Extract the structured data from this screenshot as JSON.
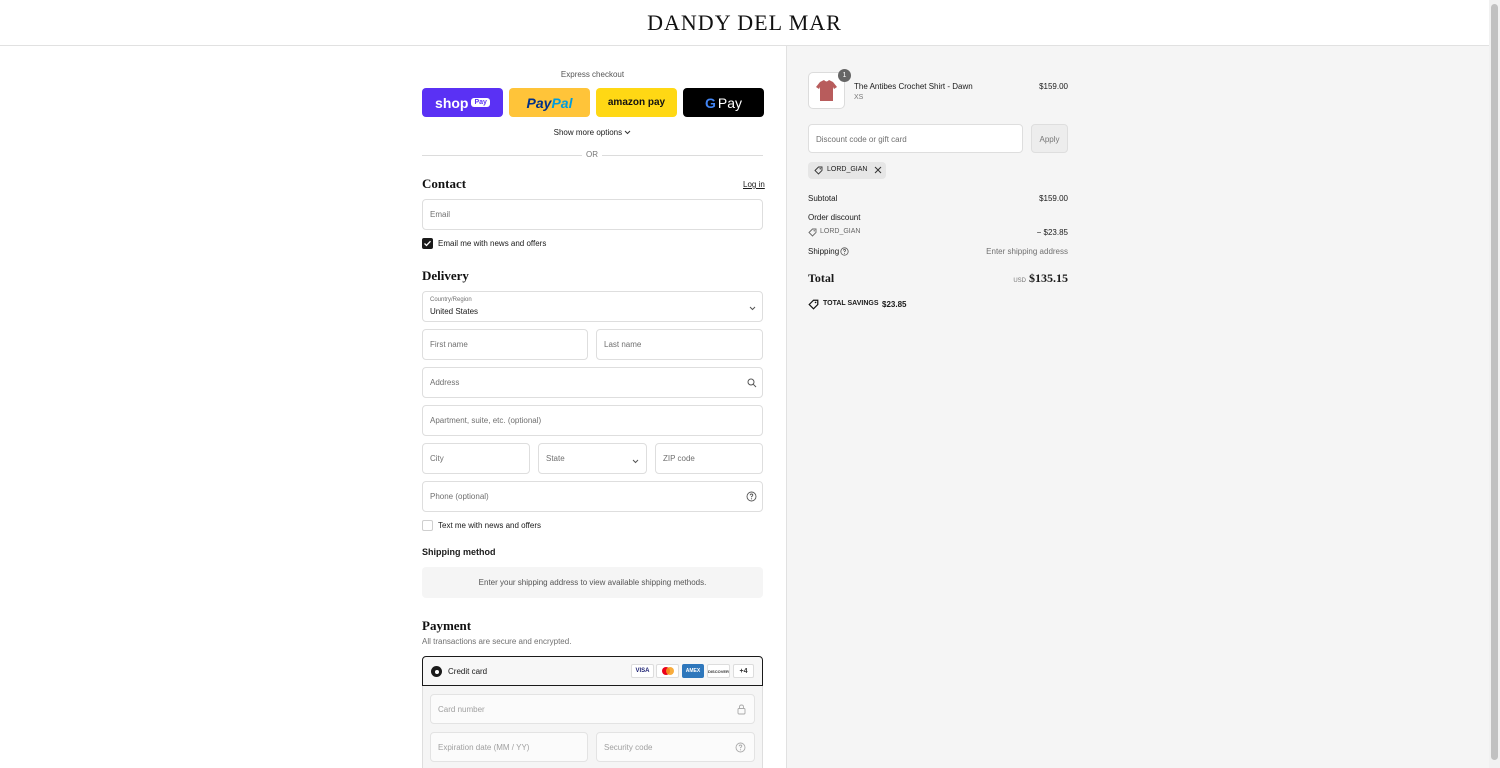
{
  "brand": "DANDY DEL MAR",
  "express": {
    "heading": "Express checkout",
    "show_more": "Show more options",
    "divider": "OR",
    "buttons": {
      "shop": "shop",
      "shop_badge": "Pay",
      "paypal_a": "Pay",
      "paypal_b": "Pal",
      "amazon": "amazon pay",
      "gpay_g": "G",
      "gpay": "Pay"
    }
  },
  "contact": {
    "title": "Contact",
    "login": "Log in",
    "email_placeholder": "Email",
    "news_label": "Email me with news and offers",
    "news_checked": true
  },
  "delivery": {
    "title": "Delivery",
    "country_label": "Country/Region",
    "country_value": "United States",
    "first_name": "First name",
    "last_name": "Last name",
    "address": "Address",
    "apartment": "Apartment, suite, etc. (optional)",
    "city": "City",
    "state": "State",
    "zip": "ZIP code",
    "phone": "Phone (optional)",
    "text_label": "Text me with news and offers",
    "text_checked": false
  },
  "shipping_method": {
    "title": "Shipping method",
    "note": "Enter your shipping address to view available shipping methods."
  },
  "payment": {
    "title": "Payment",
    "subtitle": "All transactions are secure and encrypted.",
    "method": "Credit card",
    "cards": [
      "VISA",
      "MC",
      "AMEX",
      "DISCOVER"
    ],
    "more_cards": "+4",
    "card_number": "Card number",
    "expiration": "Expiration date (MM / YY)",
    "security": "Security code"
  },
  "summary": {
    "item": {
      "name": "The Antibes Crochet Shirt - Dawn",
      "variant": "XS",
      "qty": "1",
      "price": "$159.00"
    },
    "discount_placeholder": "Discount code or gift card",
    "apply": "Apply",
    "code": "LORD_GIAN",
    "subtotal_label": "Subtotal",
    "subtotal": "$159.00",
    "order_discount_label": "Order discount",
    "discount_code": "LORD_GIAN",
    "discount_amount": "− $23.85",
    "shipping_label": "Shipping",
    "shipping_value": "Enter shipping address",
    "total_label": "Total",
    "currency": "USD",
    "total": "$135.15",
    "savings_label": "TOTAL SAVINGS",
    "savings": "$23.85"
  },
  "colors": {
    "shop_pay": "#5a31f4",
    "paypal": "#ffc439",
    "amazon": "#ffd814",
    "gpay": "#000000"
  }
}
